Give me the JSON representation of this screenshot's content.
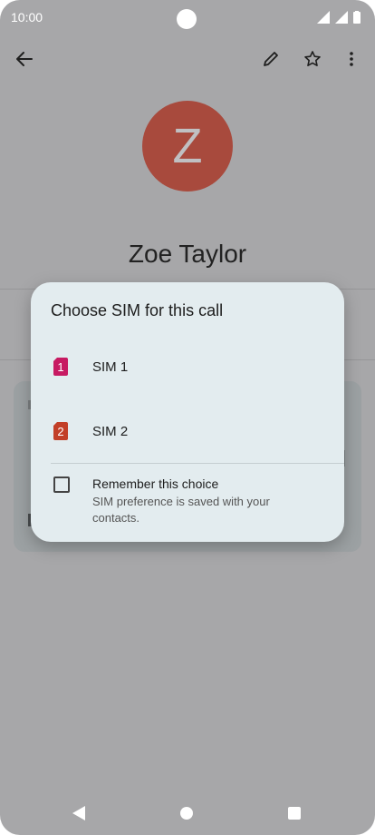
{
  "status_bar": {
    "time": "10:00"
  },
  "contact": {
    "avatar_letter": "Z",
    "name": "Zoe Taylor"
  },
  "dialog": {
    "title": "Choose SIM for this call",
    "options": [
      {
        "badge": "1",
        "label": "SIM 1",
        "color": "#c71a62"
      },
      {
        "badge": "2",
        "label": "SIM 2",
        "color": "#c23f28"
      }
    ],
    "remember": {
      "label": "Remember this choice",
      "subtext": "SIM preference is saved with your contacts.",
      "checked": false
    }
  },
  "colors": {
    "scrim_background": "#a7a7a9",
    "dialog_background": "#e3ecef",
    "avatar_background": "#a84a3d"
  },
  "icons": {
    "back": "arrow-left-icon",
    "edit": "pencil-icon",
    "favorite": "star-outline-icon",
    "more": "more-vert-icon"
  }
}
